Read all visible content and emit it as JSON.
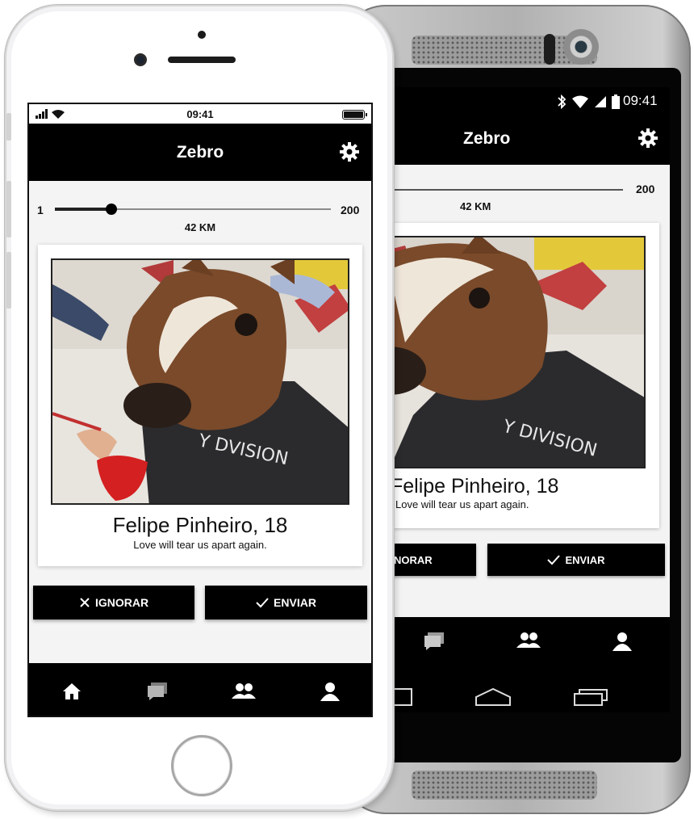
{
  "app": {
    "title": "Zebro"
  },
  "ios_status": {
    "time": "09:41"
  },
  "android_status": {
    "time": "09:41"
  },
  "distance": {
    "min": "1",
    "max": "200",
    "value_label": "42 KM",
    "value": 42,
    "min_value": 1,
    "max_value": 200
  },
  "profile": {
    "name": "Felipe Pinheiro, 18",
    "bio": "Love will tear us apart again."
  },
  "actions": {
    "ignore": "IGNORAR",
    "send": "ENVIAR"
  },
  "nav": [
    "home-icon",
    "chat-icon",
    "group-icon",
    "person-icon"
  ],
  "colors": {
    "bar": "#000000",
    "background": "#f4f4f4",
    "card": "#ffffff"
  }
}
